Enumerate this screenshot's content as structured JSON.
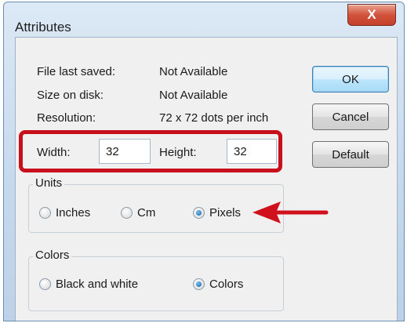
{
  "window": {
    "title": "Attributes",
    "close_label": "X"
  },
  "info": {
    "file_last_saved_label": "File last saved:",
    "file_last_saved_value": "Not Available",
    "size_on_disk_label": "Size on disk:",
    "size_on_disk_value": "Not Available",
    "resolution_label": "Resolution:",
    "resolution_value": "72 x 72 dots per inch"
  },
  "dimensions": {
    "width_label": "Width:",
    "width_value": "32",
    "height_label": "Height:",
    "height_value": "32"
  },
  "units": {
    "group_label": "Units",
    "options": [
      "Inches",
      "Cm",
      "Pixels"
    ],
    "selected": "Pixels"
  },
  "colors": {
    "group_label": "Colors",
    "options": [
      "Black and white",
      "Colors"
    ],
    "selected": "Colors"
  },
  "buttons": {
    "ok_label": "OK",
    "cancel_label": "Cancel",
    "default_label": "Default"
  },
  "annotation": {
    "highlight_color": "#c8101c",
    "arrow_color": "#d0101c"
  }
}
